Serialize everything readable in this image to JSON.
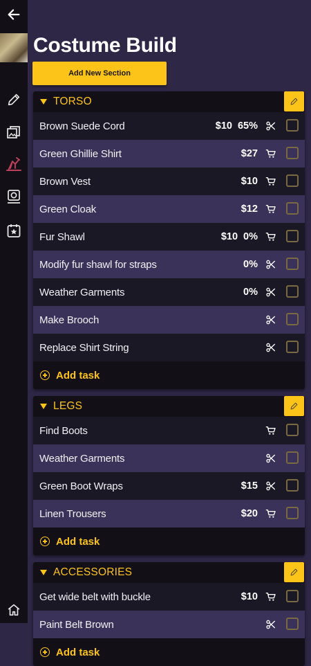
{
  "page": {
    "title": "Costume Build"
  },
  "toolbar": {
    "add_section_label": "Add New Section"
  },
  "sections": [
    {
      "title": "TORSO",
      "tasks": [
        {
          "name": "Brown Suede Cord",
          "price": "$10",
          "progress": "65%",
          "action": "scissors-icon",
          "checked": false
        },
        {
          "name": "Green Ghillie Shirt",
          "price": "$27",
          "progress": "",
          "action": "cart-icon",
          "checked": false
        },
        {
          "name": "Brown Vest",
          "price": "$10",
          "progress": "",
          "action": "cart-icon",
          "checked": false
        },
        {
          "name": "Green Cloak",
          "price": "$12",
          "progress": "",
          "action": "cart-icon",
          "checked": false
        },
        {
          "name": "Fur Shawl",
          "price": "$10",
          "progress": "0%",
          "action": "cart-icon",
          "checked": false
        },
        {
          "name": "Modify fur shawl for straps",
          "price": "",
          "progress": "0%",
          "action": "scissors-icon",
          "checked": false
        },
        {
          "name": "Weather Garments",
          "price": "",
          "progress": "0%",
          "action": "scissors-icon",
          "checked": false
        },
        {
          "name": "Make Brooch",
          "price": "",
          "progress": "",
          "action": "scissors-icon",
          "checked": false
        },
        {
          "name": "Replace Shirt String",
          "price": "",
          "progress": "",
          "action": "scissors-icon",
          "checked": false
        }
      ],
      "add_task_label": "Add task"
    },
    {
      "title": "LEGS",
      "tasks": [
        {
          "name": "Find Boots",
          "price": "",
          "progress": "",
          "action": "cart-icon",
          "checked": false
        },
        {
          "name": "Weather Garments",
          "price": "",
          "progress": "",
          "action": "scissors-icon",
          "checked": false
        },
        {
          "name": "Green Boot Wraps",
          "price": "$15",
          "progress": "",
          "action": "scissors-icon",
          "checked": false
        },
        {
          "name": "Linen Trousers",
          "price": "$20",
          "progress": "",
          "action": "cart-icon",
          "checked": false
        }
      ],
      "add_task_label": "Add task"
    },
    {
      "title": "ACCESSORIES",
      "tasks": [
        {
          "name": "Get wide belt with buckle",
          "price": "$10",
          "progress": "",
          "action": "cart-icon",
          "checked": false
        },
        {
          "name": "Paint Belt Brown",
          "price": "",
          "progress": "",
          "action": "scissors-icon",
          "checked": false
        }
      ],
      "add_task_label": "Add task"
    }
  ],
  "colors": {
    "accent": "#fcc419",
    "background": "#2f2746",
    "row_dark": "#1b1826",
    "row_light": "#3b3259",
    "rail": "#121016",
    "active_nav": "#c0405b"
  },
  "nav": {
    "back": "back-arrow-icon",
    "items": [
      "pencil-icon",
      "reference-images-icon",
      "sewing-machine-icon",
      "camera-icon",
      "calendar-star-icon"
    ],
    "active": "sewing-machine-icon",
    "home": "home-icon"
  }
}
